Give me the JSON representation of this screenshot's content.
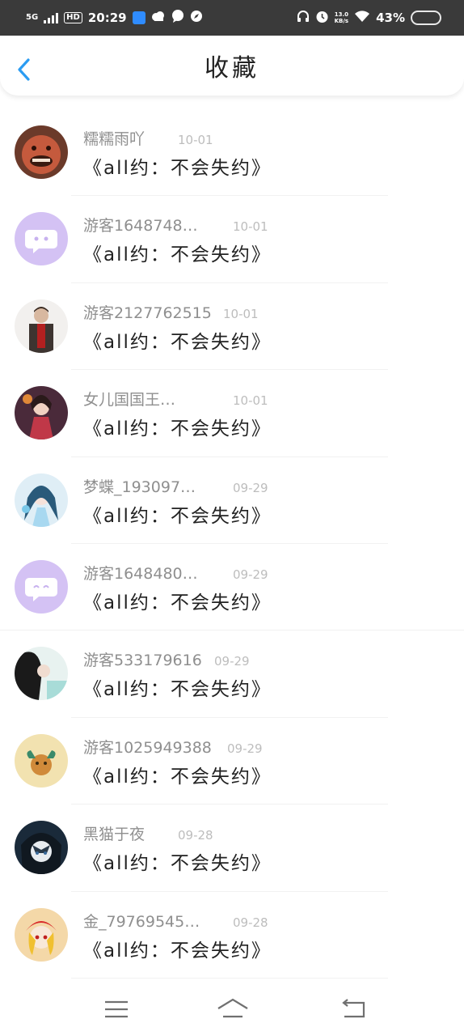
{
  "status_bar": {
    "network": "5G",
    "hd": "HD",
    "time": "20:29",
    "net_speed_value": "13.0",
    "net_speed_unit": "KB/s",
    "battery": "43%",
    "battery_level": 0.43,
    "icons": [
      "signal-icon",
      "app-notification-icon",
      "cloud-icon",
      "chat-bubble-icon",
      "compass-icon",
      "headphones-icon",
      "alarm-icon",
      "wifi-icon",
      "battery-icon"
    ]
  },
  "header": {
    "title": "收藏",
    "back_icon": "back-arrow-icon",
    "accent": "#2b9cf2"
  },
  "items": [
    {
      "name": "糯糯雨吖",
      "time": "10-01",
      "text": "《all约：不会失约》",
      "avatar": "avatar-icon"
    },
    {
      "name": "游客1648748…",
      "time": "10-01",
      "text": "《all约：不会失约》",
      "avatar": "default-chat-avatar-icon"
    },
    {
      "name": "游客2127762515",
      "time": "10-01",
      "text": "《all约：不会失约》",
      "avatar": "avatar-icon"
    },
    {
      "name": "女儿国国王…",
      "time": "10-01",
      "text": "《all约：不会失约》",
      "avatar": "avatar-icon"
    },
    {
      "name": "梦蝶_193097…",
      "time": "09-29",
      "text": "《all约：不会失约》",
      "avatar": "avatar-icon"
    },
    {
      "name": "游客1648480…",
      "time": "09-29",
      "text": "《all约：不会失约》",
      "avatar": "default-chat-avatar-icon"
    },
    {
      "name": "游客533179616",
      "time": "09-29",
      "text": "《all约：不会失约》",
      "avatar": "avatar-icon"
    },
    {
      "name": "游客1025949388",
      "time": "09-29",
      "text": "《all约：不会失约》",
      "avatar": "avatar-icon"
    },
    {
      "name": "黑猫于夜",
      "time": "09-28",
      "text": "《all约：不会失约》",
      "avatar": "avatar-icon"
    },
    {
      "name": "金_79769545…",
      "time": "09-28",
      "text": "《all约：不会失约》",
      "avatar": "avatar-icon"
    }
  ],
  "bottom_nav": {
    "buttons": [
      "menu-icon",
      "home-icon",
      "back-icon"
    ]
  }
}
